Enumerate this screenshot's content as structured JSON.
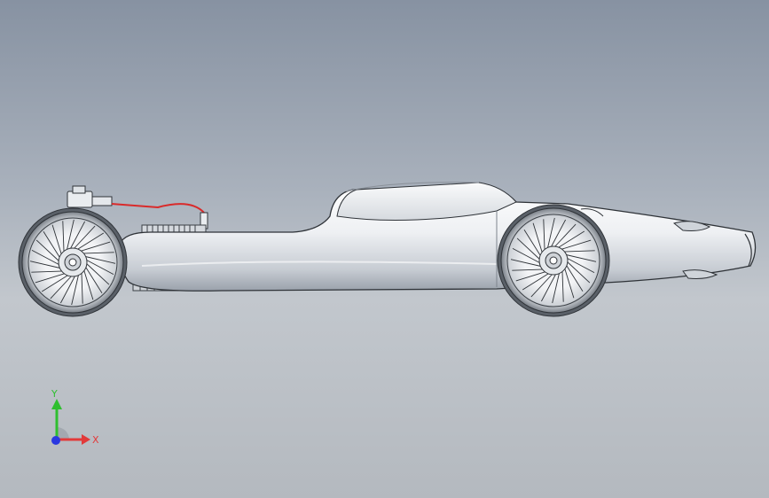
{
  "model": {
    "name": "race-car-assembly-side-view",
    "colors": {
      "body_light": "#f6f7f9",
      "body_mid": "#d9dde3",
      "body_shadow": "#9aa1ab",
      "outline": "#2f3338",
      "tire": "#4a4f55",
      "accent_line": "#d92a2a",
      "green_part": "#3b9a3b"
    }
  },
  "triad": {
    "y_label": "Y",
    "x_label": "X",
    "y_color": "#2fbf2f",
    "x_color": "#e23a3a",
    "z_color": "#2a38e0"
  }
}
